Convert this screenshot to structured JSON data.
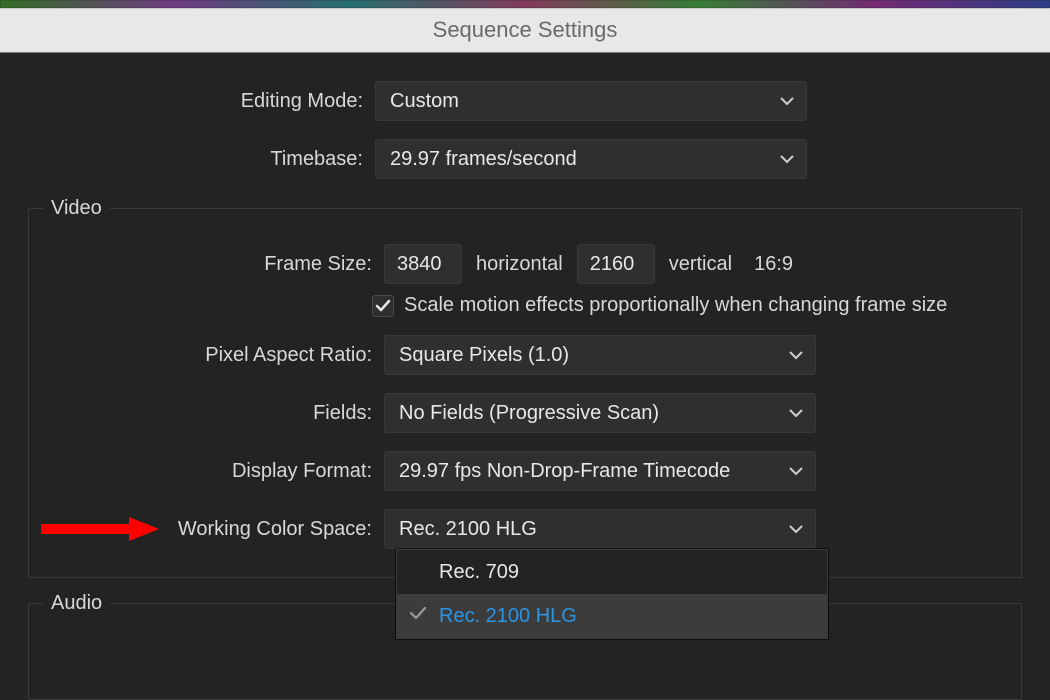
{
  "window": {
    "title": "Sequence Settings"
  },
  "general": {
    "editing_mode_label": "Editing Mode:",
    "editing_mode_value": "Custom",
    "timebase_label": "Timebase:",
    "timebase_value": "29.97  frames/second"
  },
  "video": {
    "legend": "Video",
    "frame_size_label": "Frame Size:",
    "frame_width": "3840",
    "frame_width_unit": "horizontal",
    "frame_height": "2160",
    "frame_height_unit": "vertical",
    "aspect_display": "16:9",
    "scale_checkbox_label": "Scale motion effects proportionally when changing frame size",
    "par_label": "Pixel Aspect Ratio:",
    "par_value": "Square Pixels (1.0)",
    "fields_label": "Fields:",
    "fields_value": "No Fields (Progressive Scan)",
    "display_format_label": "Display Format:",
    "display_format_value": "29.97 fps Non-Drop-Frame Timecode",
    "color_space_label": "Working Color Space:",
    "color_space_value": "Rec. 2100 HLG",
    "color_space_options": {
      "opt0": "Rec. 709",
      "opt1": "Rec. 2100 HLG"
    }
  },
  "audio": {
    "legend": "Audio"
  }
}
